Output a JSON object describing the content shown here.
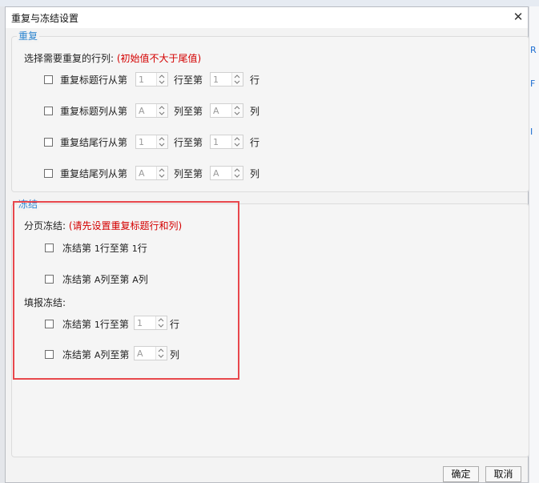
{
  "dialog": {
    "title": "重复与冻结设置",
    "close_glyph": "✕"
  },
  "repeat_group": {
    "legend": "重复",
    "instruction": "选择需要重复的行列:",
    "instruction_note": "(初始值不大于尾值)",
    "rows": [
      {
        "label": "重复标题行从第",
        "from": "1",
        "mid": "行至第",
        "to": "1",
        "unit": "行"
      },
      {
        "label": "重复标题列从第",
        "from": "A",
        "mid": "列至第",
        "to": "A",
        "unit": "列"
      },
      {
        "label": "重复结尾行从第",
        "from": "1",
        "mid": "行至第",
        "to": "1",
        "unit": "行"
      },
      {
        "label": "重复结尾列从第",
        "from": "A",
        "mid": "列至第",
        "to": "A",
        "unit": "列"
      }
    ]
  },
  "freeze_group": {
    "legend": "冻结",
    "paging_title": "分页冻结:",
    "paging_note": "(请先设置重复标题行和列)",
    "paging_rows": [
      {
        "prefix": "冻结第",
        "from": "1",
        "mid": "行至第",
        "to": "1",
        "unit": "行"
      },
      {
        "prefix": "冻结第",
        "from": "A",
        "mid": "列至第",
        "to": "A",
        "unit": "列"
      }
    ],
    "fill_title": "填报冻结:",
    "fill_rows": [
      {
        "prefix": "冻结第",
        "from": "1",
        "mid": "行至第",
        "to": "1",
        "unit": "行"
      },
      {
        "prefix": "冻结第",
        "from": "A",
        "mid": "列至第",
        "to": "A",
        "unit": "列"
      }
    ]
  },
  "buttons": {
    "ok": "确定",
    "cancel": "取消"
  },
  "side_marks": [
    "R",
    "F",
    "I"
  ],
  "colors": {
    "legend_blue": "#2f86d0",
    "note_red": "#d40000",
    "highlight_box": "#e8474c"
  }
}
